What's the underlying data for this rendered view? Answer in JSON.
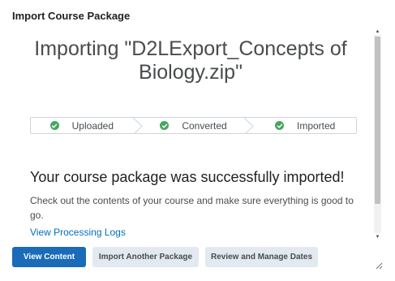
{
  "dialog": {
    "title": "Import Course Package"
  },
  "main": {
    "heading": "Importing \"D2LExport_Concepts of Biology.zip\"",
    "steps": [
      {
        "label": "Uploaded",
        "status": "complete",
        "icon": "check-circle-icon"
      },
      {
        "label": "Converted",
        "status": "complete",
        "icon": "check-circle-icon"
      },
      {
        "label": "Imported",
        "status": "complete",
        "icon": "check-circle-icon"
      }
    ],
    "success_message": "Your course package was successfully imported!",
    "sub_message": "Check out the contents of your course and make sure everything is good to go.",
    "logs_link": "View Processing Logs"
  },
  "footer": {
    "view_content": "View Content",
    "import_another": "Import Another Package",
    "review_dates": "Review and Manage Dates"
  },
  "colors": {
    "primary": "#1a6bb8",
    "success": "#46a661",
    "link": "#006fbf",
    "secondary_button": "#e3e9f1"
  }
}
